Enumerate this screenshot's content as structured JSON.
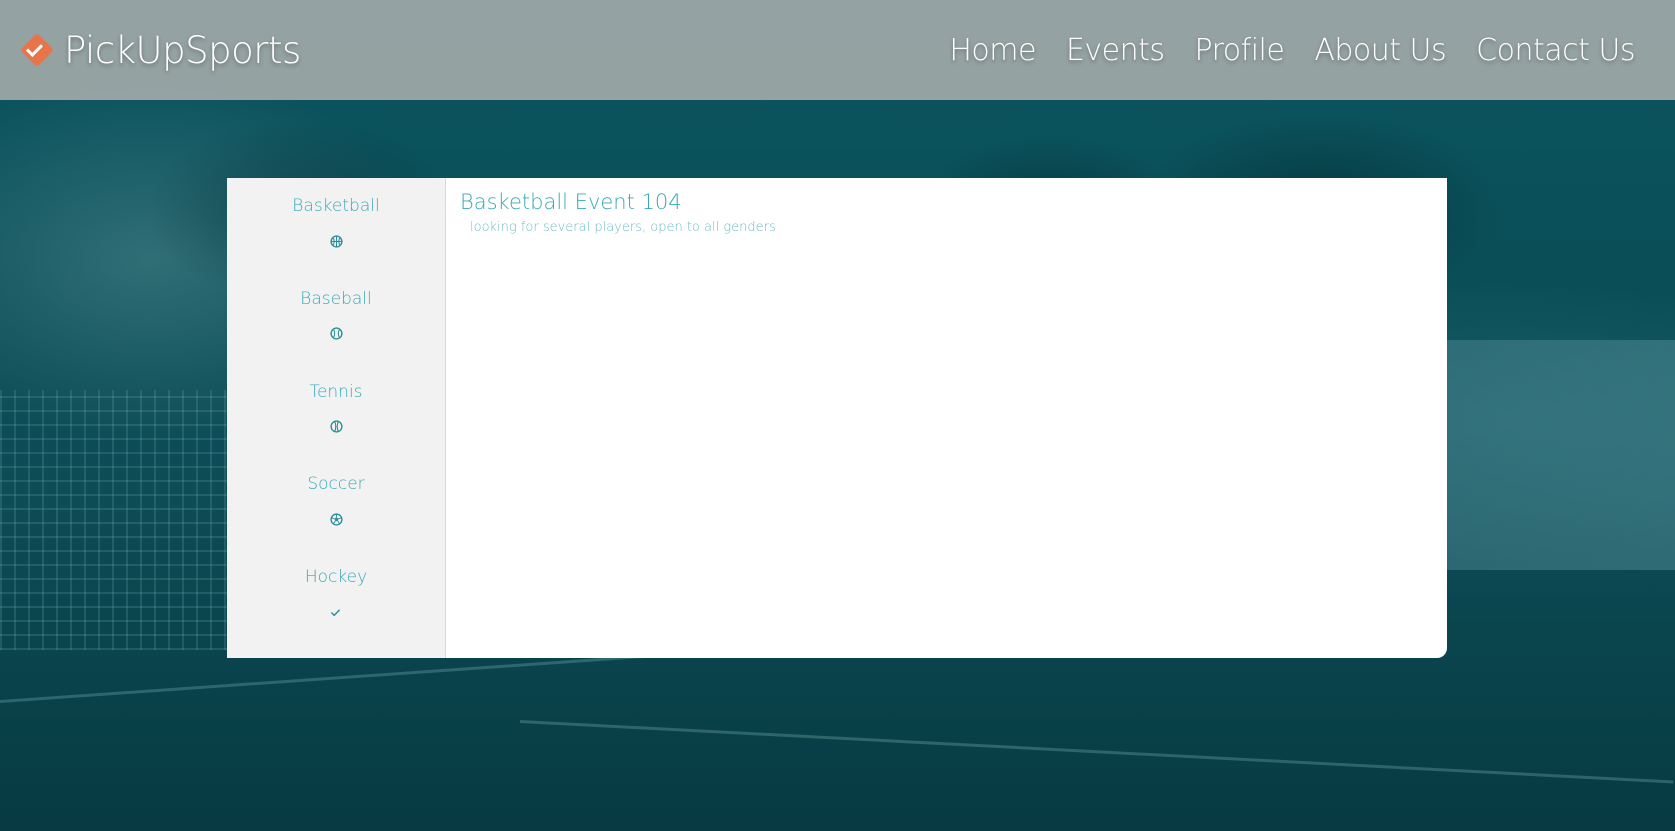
{
  "brand": {
    "name": "PickUpSports",
    "logo_icon": "checkmark-diamond-icon",
    "logo_color": "#e8744a"
  },
  "nav": {
    "items": [
      {
        "label": "Home"
      },
      {
        "label": "Events"
      },
      {
        "label": "Profile"
      },
      {
        "label": "About Us"
      },
      {
        "label": "Contact Us"
      }
    ]
  },
  "sidebar": {
    "items": [
      {
        "label": "Basketball",
        "icon": "basketball-icon",
        "glyph": "⊛"
      },
      {
        "label": "Baseball",
        "icon": "baseball-icon",
        "glyph": "⚾"
      },
      {
        "label": "Tennis",
        "icon": "tennis-ball-icon",
        "glyph": "◍"
      },
      {
        "label": "Soccer",
        "icon": "soccer-ball-icon",
        "glyph": "⚽"
      },
      {
        "label": "Hockey",
        "icon": "check-icon",
        "glyph": "✓"
      }
    ]
  },
  "event": {
    "title": "Basketball Event 104",
    "description": "looking for several players, open to all genders"
  },
  "colors": {
    "accent": "#3aa9b5",
    "header_bg": "#a0a8a8",
    "background": "#0a4a52"
  }
}
